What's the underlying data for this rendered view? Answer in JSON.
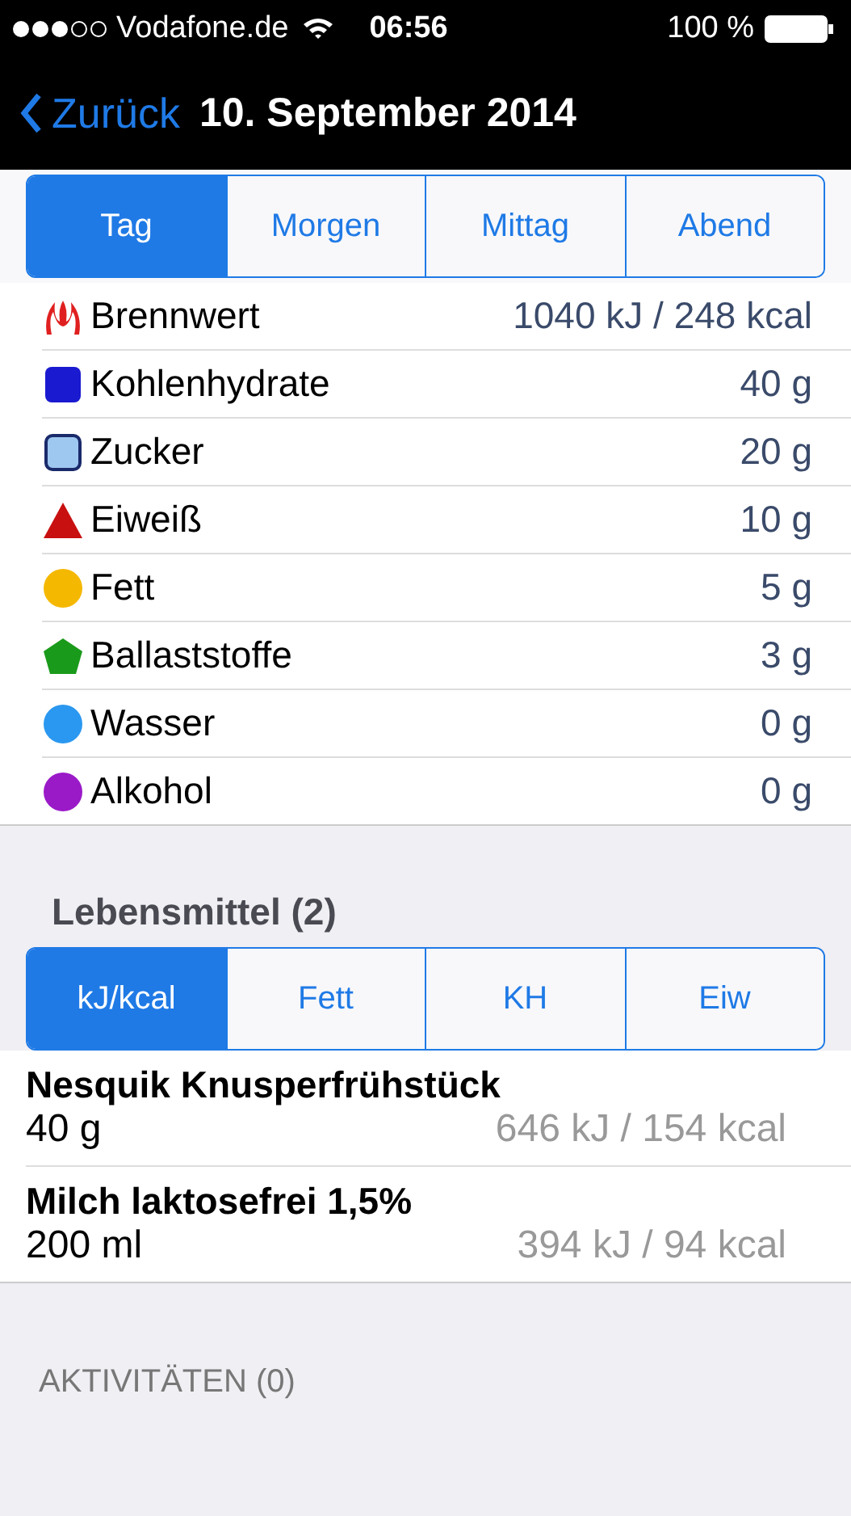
{
  "status_bar": {
    "carrier": "Vodafone.de",
    "time": "06:56",
    "battery": "100 %"
  },
  "nav": {
    "back": "Zurück",
    "title": "10. September 2014"
  },
  "period_tabs": [
    {
      "label": "Tag",
      "selected": true
    },
    {
      "label": "Morgen",
      "selected": false
    },
    {
      "label": "Mittag",
      "selected": false
    },
    {
      "label": "Abend",
      "selected": false
    }
  ],
  "nutrients": [
    {
      "name": "Brennwert",
      "value": "1040 kJ / 248 kcal",
      "kind": "flame",
      "color": "#e02020"
    },
    {
      "name": "Kohlenhydrate",
      "value": "40 g",
      "kind": "square",
      "color": "#1a1ad0"
    },
    {
      "name": "Zucker",
      "value": "20 g",
      "kind": "outline-square",
      "color": "#9fc8f0"
    },
    {
      "name": "Eiweiß",
      "value": "10 g",
      "kind": "triangle",
      "color": "#c81010"
    },
    {
      "name": "Fett",
      "value": "5 g",
      "kind": "circle",
      "color": "#f5b800"
    },
    {
      "name": "Ballaststoffe",
      "value": "3 g",
      "kind": "pentagon",
      "color": "#1a9a1a"
    },
    {
      "name": "Wasser",
      "value": "0 g",
      "kind": "circle",
      "color": "#2a98f0"
    },
    {
      "name": "Alkohol",
      "value": "0 g",
      "kind": "circle",
      "color": "#9a1ac8"
    }
  ],
  "foods_header": "Lebensmittel (2)",
  "unit_tabs": [
    {
      "label": "kJ/kcal",
      "selected": true
    },
    {
      "label": "Fett",
      "selected": false
    },
    {
      "label": "KH",
      "selected": false
    },
    {
      "label": "Eiw",
      "selected": false
    }
  ],
  "foods": [
    {
      "name": "Nesquik Knusperfrühstück",
      "amount": "40 g",
      "energy": "646 kJ / 154 kcal"
    },
    {
      "name": "Milch laktosefrei 1,5%",
      "amount": "200 ml",
      "energy": "394 kJ / 94 kcal"
    }
  ],
  "activities_header": "AKTIVITÄTEN (0)"
}
